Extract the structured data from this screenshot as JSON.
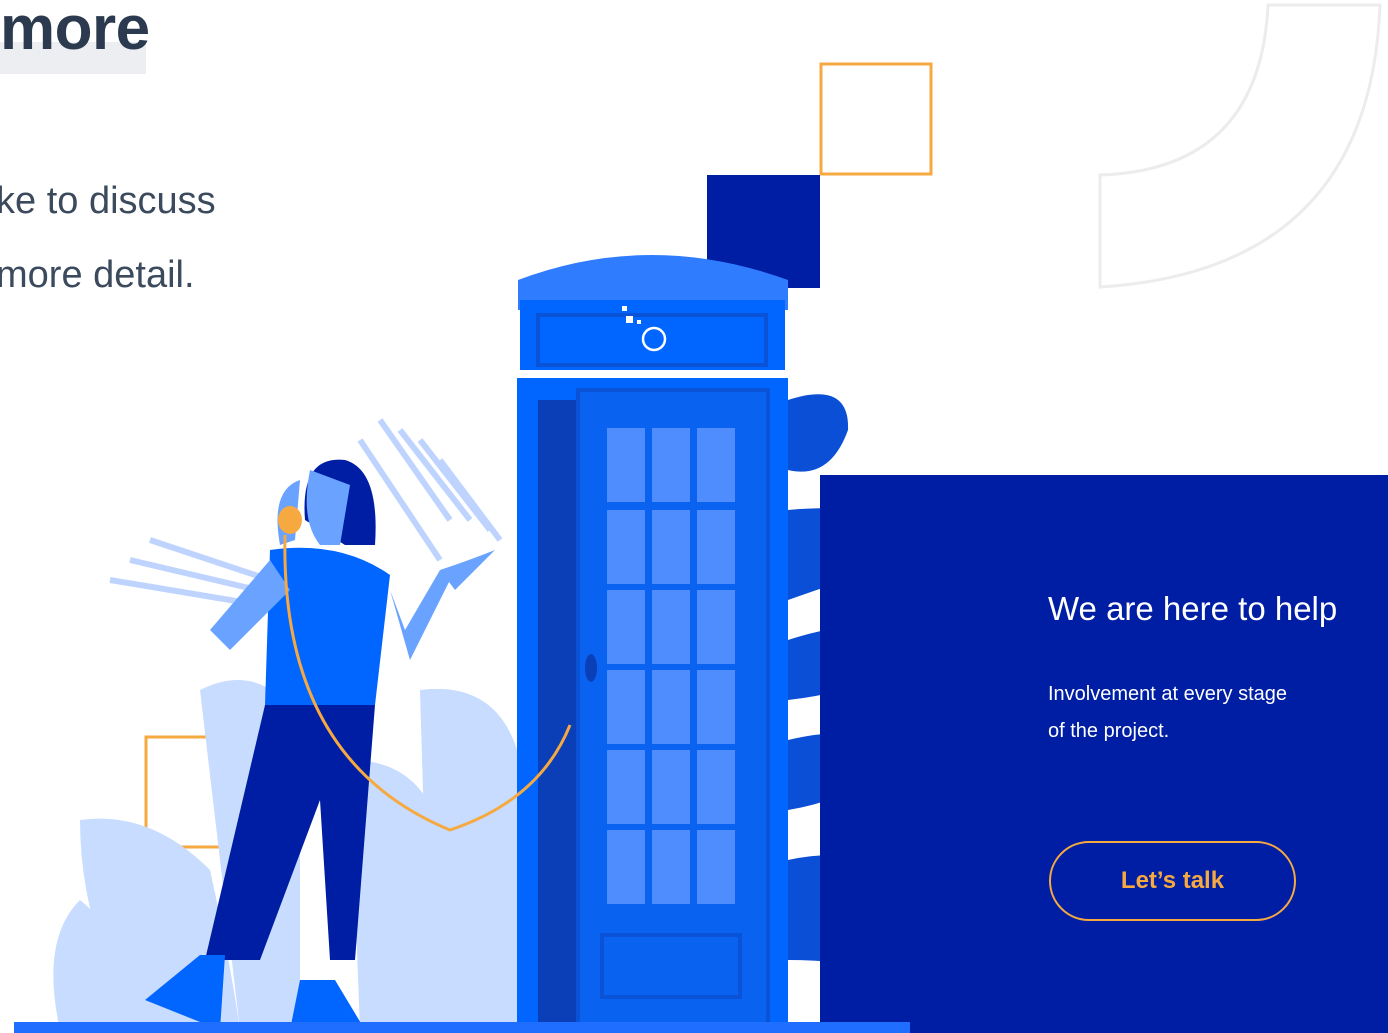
{
  "section": {
    "heading": "more",
    "intro_lines": [
      "ke to discuss",
      "more detail."
    ]
  },
  "help_panel": {
    "title": "We are here to help",
    "description_lines": [
      "Involvement at every stage",
      "of the project."
    ],
    "cta_label": "Let’s talk"
  },
  "colors": {
    "primary_blue": "#0066ff",
    "navy": "#001ea3",
    "accent_orange": "#f6a940",
    "light_blue": "#c8dcff"
  },
  "icons": {
    "booth_logo": "logo-icon"
  }
}
